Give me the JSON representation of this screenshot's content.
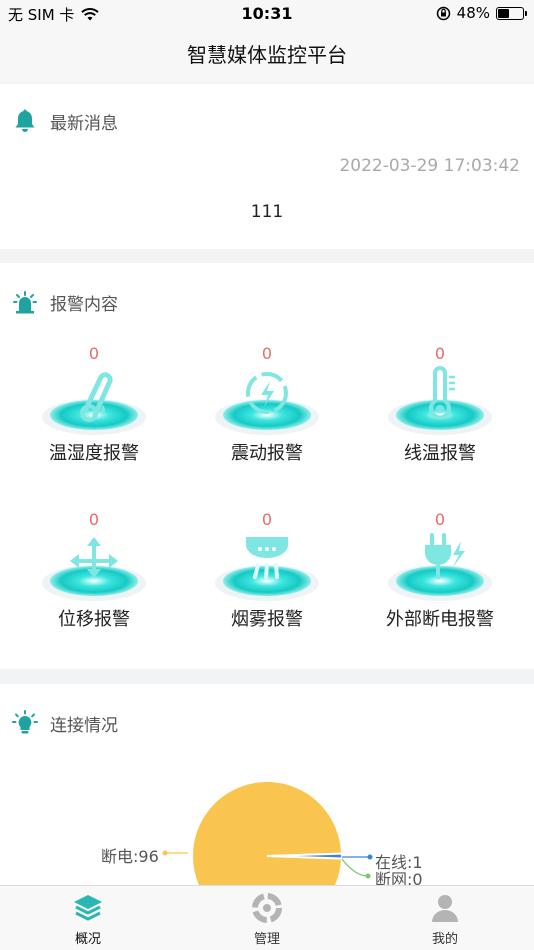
{
  "status": {
    "carrier": "无 SIM 卡",
    "time": "10:31",
    "battery": "48%",
    "battery_level": 0.48
  },
  "nav": {
    "title": "智慧媒体监控平台"
  },
  "news": {
    "title": "最新消息",
    "timestamp": "2022-03-29 17:03:42",
    "content": "111"
  },
  "alarms": {
    "title": "报警内容",
    "items": [
      {
        "label": "温湿度报警",
        "count": "0",
        "icon": "thermometer-humidity-icon"
      },
      {
        "label": "震动报警",
        "count": "0",
        "icon": "vibration-icon"
      },
      {
        "label": "线温报警",
        "count": "0",
        "icon": "line-temperature-icon"
      },
      {
        "label": "位移报警",
        "count": "0",
        "icon": "displacement-icon"
      },
      {
        "label": "烟雾报警",
        "count": "0",
        "icon": "smoke-detector-icon"
      },
      {
        "label": "外部断电报警",
        "count": "0",
        "icon": "power-plug-icon"
      }
    ]
  },
  "connection": {
    "title": "连接情况",
    "chart_data": {
      "type": "pie",
      "categories": [
        "断电",
        "在线",
        "断网"
      ],
      "values": [
        96,
        1,
        0
      ],
      "labels": [
        "断电:96",
        "在线:1",
        "断网:0"
      ],
      "colors": [
        "#f9c54f",
        "#3a86d6",
        "#7bc86a"
      ],
      "legend": "none"
    }
  },
  "tabs": [
    {
      "label": "概况",
      "icon": "overview-layers-icon",
      "active": true
    },
    {
      "label": "管理",
      "icon": "management-icon",
      "active": false
    },
    {
      "label": "我的",
      "icon": "user-icon",
      "active": false
    }
  ],
  "colors": {
    "accent": "#1fb8b5",
    "alarm_count": "#e86a6a",
    "pie_main": "#f9c54f"
  }
}
